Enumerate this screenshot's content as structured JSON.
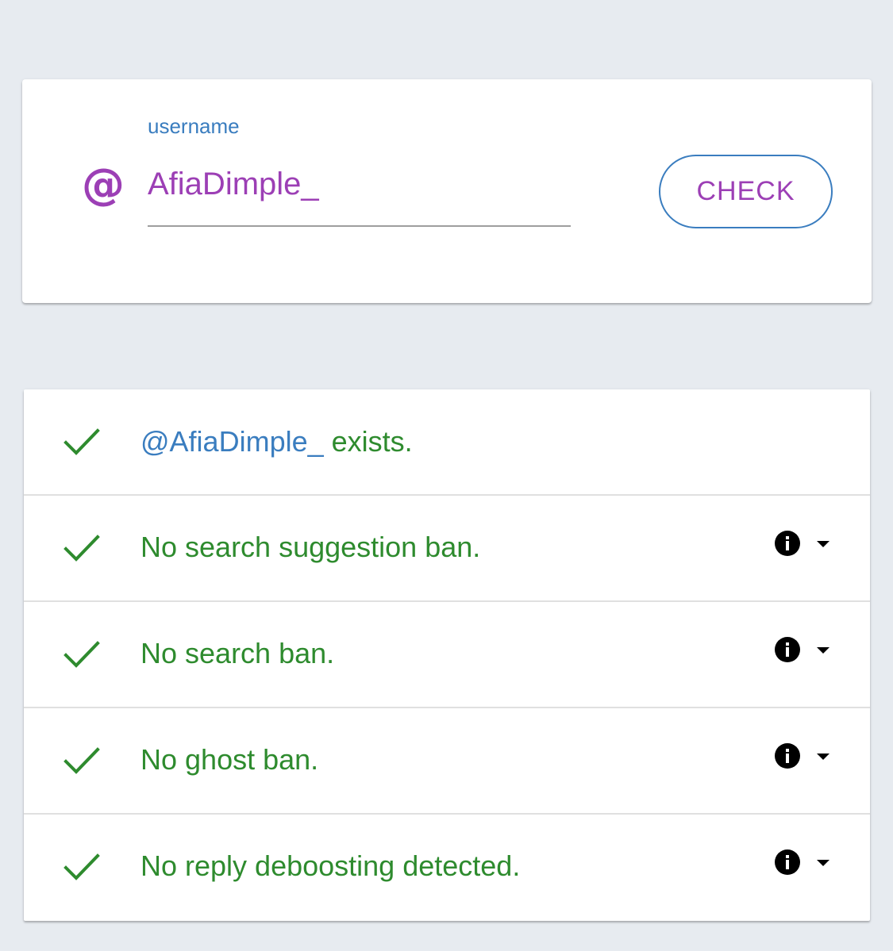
{
  "search": {
    "label": "username",
    "prefix_icon": "at-sign-icon",
    "prefix_symbol": "@",
    "value": "AfiaDimple_",
    "button_label": "CHECK"
  },
  "results": {
    "exists": {
      "handle": "@AfiaDimple_",
      "suffix": "exists."
    },
    "items": [
      {
        "label": "No search suggestion ban.",
        "icon": "check-icon",
        "info_icon": "info-icon",
        "expand_icon": "caret-down-icon"
      },
      {
        "label": "No search ban.",
        "icon": "check-icon",
        "info_icon": "info-icon",
        "expand_icon": "caret-down-icon"
      },
      {
        "label": "No ghost ban.",
        "icon": "check-icon",
        "info_icon": "info-icon",
        "expand_icon": "caret-down-icon"
      },
      {
        "label": "No reply deboosting detected.",
        "icon": "check-icon",
        "info_icon": "info-icon",
        "expand_icon": "caret-down-icon"
      }
    ]
  },
  "colors": {
    "background": "#e7ebf0",
    "card": "#ffffff",
    "accent_purple": "#9c3fb5",
    "accent_blue": "#3a7dbf",
    "success_green": "#2e8b2e",
    "divider": "#e0e0e0"
  }
}
